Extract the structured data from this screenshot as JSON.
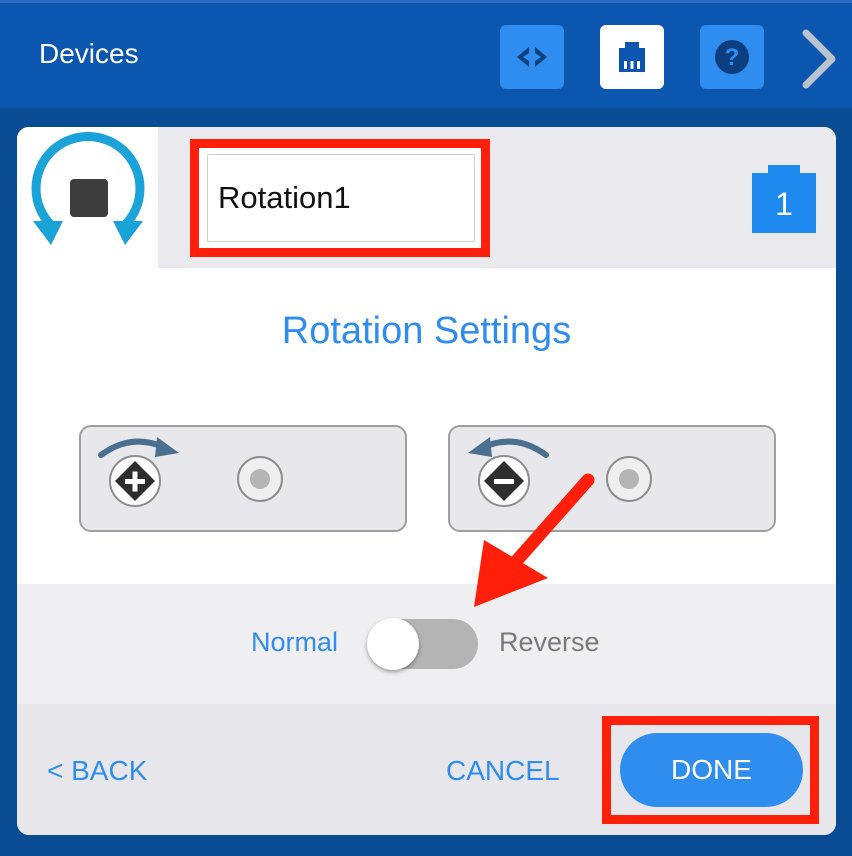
{
  "header": {
    "title": "Devices",
    "buttons": [
      {
        "icon": "code-brackets-icon"
      },
      {
        "icon": "port-icon"
      },
      {
        "icon": "help-icon",
        "label": "?"
      },
      {
        "icon": "chevron-right-icon"
      }
    ]
  },
  "device": {
    "icon": "rotation-sensor-icon",
    "name": "Rotation1",
    "port": "1"
  },
  "settings": {
    "title": "Rotation Settings",
    "options": [
      {
        "icon": "rotate-forward-plus-icon",
        "selected": false
      },
      {
        "icon": "rotate-reverse-minus-icon",
        "selected": false
      }
    ]
  },
  "direction": {
    "normal_label": "Normal",
    "reverse_label": "Reverse",
    "is_reverse": false
  },
  "footer": {
    "back_label": "< BACK",
    "cancel_label": "CANCEL",
    "done_label": "DONE"
  },
  "colors": {
    "accent": "#2f8df0",
    "header_bg": "#0b56ae",
    "annotation": "#ff1f0a"
  }
}
